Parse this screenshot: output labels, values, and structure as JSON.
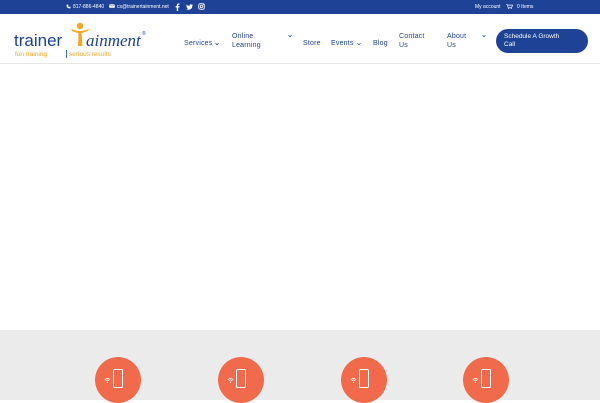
{
  "topbar": {
    "phone": "817-886-4840",
    "email": "cs@trainertainment.net",
    "my_account": "My account",
    "cart": "0 Items"
  },
  "logo": {
    "brand_left": "trainer",
    "brand_right": "ainment",
    "tagline_left": "fun training",
    "tagline_right": "serious results",
    "registered": "®"
  },
  "nav": {
    "services": "Services",
    "online_learning_line1": "Online",
    "online_learning_line2": "Learning",
    "store": "Store",
    "events": "Events",
    "blog": "Blog",
    "contact_line1": "Contact",
    "contact_line2": "Us",
    "about_line1": "About",
    "about_line2": "Us",
    "cta_line1": "Schedule A Growth",
    "cta_line2": "Call"
  },
  "colors": {
    "brand_blue": "#1e4296",
    "accent_orange": "#f26a4c",
    "logo_gold": "#f5a623",
    "features_bg": "#ebebeb"
  },
  "features": {
    "icons": [
      "phone-icon",
      "phone-icon",
      "phone-icon",
      "phone-icon"
    ]
  }
}
